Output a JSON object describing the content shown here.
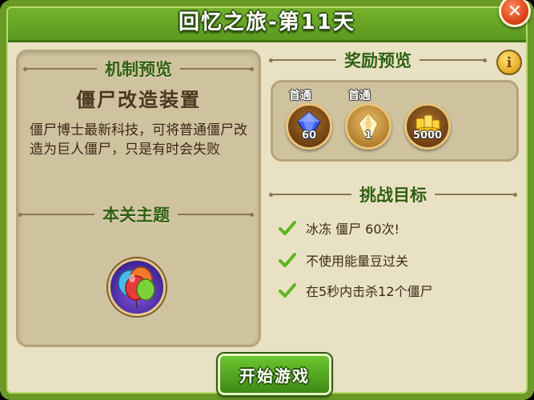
{
  "header": {
    "title": "回忆之旅-第11天",
    "close_icon": "close-icon"
  },
  "mechanics": {
    "heading": "机制预览",
    "name": "僵尸改造装置",
    "description": "僵尸博士最新科技，可将普通僵尸改造为巨人僵尸，只是有时会失败"
  },
  "theme": {
    "heading": "本关主题",
    "icon": "balloon-theme-icon"
  },
  "rewards": {
    "heading": "奖励预览",
    "info_icon": "info-icon",
    "items": [
      {
        "label": "首通",
        "count": "60",
        "icon": "gem-icon"
      },
      {
        "label": "首通",
        "count": "1",
        "icon": "crystal-icon"
      },
      {
        "label": "",
        "count": "5000",
        "icon": "gold-coins-icon"
      }
    ]
  },
  "goals": {
    "heading": "挑战目标",
    "items": [
      "冰冻 僵尸 60次!",
      "不使用能量豆过关",
      "在5秒内击杀12个僵尸"
    ]
  },
  "start_button": {
    "label": "开始游戏"
  },
  "colors": {
    "frame": "#6a9a26",
    "panel": "#cfc29f",
    "heading": "#305f12",
    "button": "#4fa820"
  }
}
